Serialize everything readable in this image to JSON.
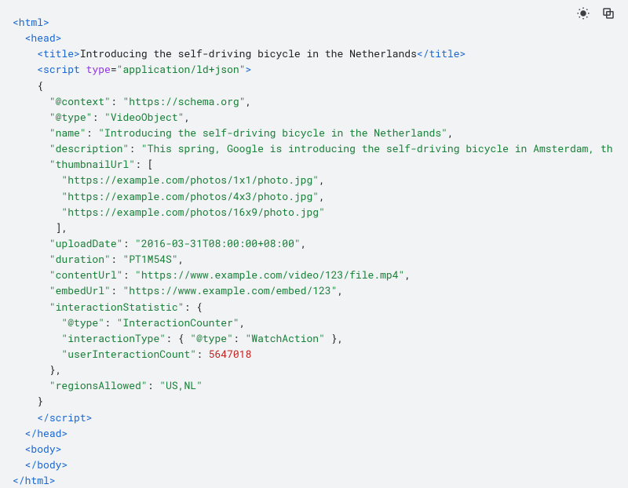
{
  "title_text": "Introducing the self-driving bicycle in the Netherlands",
  "script_type": "application/ld+json",
  "json_ld": {
    "@context": "https://schema.org",
    "@type": "VideoObject",
    "name": "Introducing the self-driving bicycle in the Netherlands",
    "description": "This spring, Google is introducing the self-driving bicycle in Amsterdam, th",
    "thumbnailUrl": [
      "https://example.com/photos/1x1/photo.jpg",
      "https://example.com/photos/4x3/photo.jpg",
      "https://example.com/photos/16x9/photo.jpg"
    ],
    "uploadDate": "2016-03-31T08:00:00+08:00",
    "duration": "PT1M54S",
    "contentUrl": "https://www.example.com/video/123/file.mp4",
    "embedUrl": "https://www.example.com/embed/123",
    "interactionStatistic": {
      "@type": "InteractionCounter",
      "interactionType": {
        "@type": "WatchAction"
      },
      "userInteractionCount": 5647018
    },
    "regionsAllowed": "US,NL"
  },
  "icons": {
    "theme": "theme-toggle-icon",
    "copy": "copy-icon"
  }
}
